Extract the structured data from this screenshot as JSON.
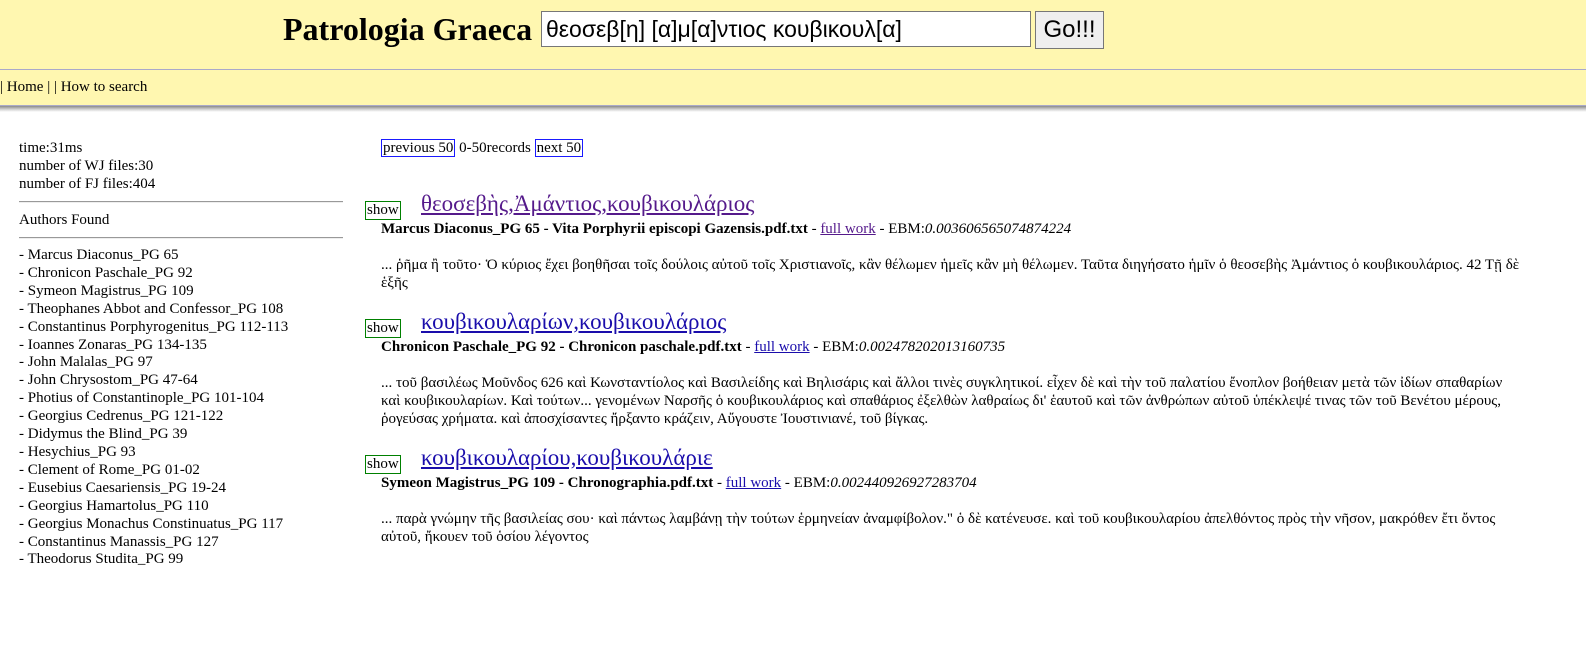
{
  "header": {
    "title": "Patrologia Graeca",
    "search_value": "θεοσεβ[η] [α]μ[α]ντιος κουβικουλ[α]",
    "go_label": "Go!!!"
  },
  "nav": {
    "home": "Home",
    "how_to_search": "How to search"
  },
  "stats": {
    "time": "time:31ms",
    "wj_files": "number of WJ files:30",
    "fj_files": "number of FJ files:404"
  },
  "authors": {
    "title": "Authors Found",
    "items": [
      "- Marcus Diaconus_PG 65",
      "- Chronicon Paschale_PG 92",
      "- Symeon Magistrus_PG 109",
      "- Theophanes Abbot and Confessor_PG 108",
      "- Constantinus Porphyrogenitus_PG 112-113",
      "- Ioannes Zonaras_PG 134-135",
      "- John Malalas_PG 97",
      "- John Chrysostom_PG 47-64",
      "- Photius of Constantinople_PG 101-104",
      "- Georgius Cedrenus_PG 121-122",
      "- Didymus the Blind_PG 39",
      "- Hesychius_PG 93",
      "- Clement of Rome_PG 01-02",
      "- Eusebius Caesariensis_PG 19-24",
      "- Georgius Hamartolus_PG 110",
      "- Georgius Monachus Constinuatus_PG 117",
      "- Constantinus Manassis_PG 127",
      "- Theodorus Studita_PG 99"
    ]
  },
  "pager": {
    "previous": "previous 50",
    "range": "0-50records",
    "next": "next 50"
  },
  "results": [
    {
      "show": "show",
      "title": "θεοσεβὴς,Ἀμάντιος,κουβικουλάριος",
      "source": "Marcus Diaconus_PG 65 - Vita Porphyrii episcopi Gazensis.pdf.txt",
      "full_work": "full work",
      "ebm_label": "- EBM:",
      "ebm": "0.003606565074874224",
      "snippet": "... ῥῆμα ἢ τοῦτο· Ὁ κύριος ἔχει βοηθῆσαι τοῖς δούλοις αὐτοῦ τοῖς Χριστιανοῖς, κἂν θέλωμεν ἡμεῖς κἂν μὴ θέλωμεν. Ταῦτα διηγήσατο ἡμῖν ὁ θεοσεβὴς Ἀμάντιος ὁ κουβικουλάριος. 42 Τῇ δὲ ἑξῆς"
    },
    {
      "show": "show",
      "title": "κουβικουλαρίων,κουβικουλάριος",
      "source": "Chronicon Paschale_PG 92 - Chronicon paschale.pdf.txt",
      "full_work": "full work",
      "ebm_label": "- EBM:",
      "ebm": "0.002478202013160735",
      "snippet": "... τοῦ βασιλέως Μοῦνδος 626 καὶ Κωνσταντίολος καὶ Βασιλείδης καὶ Βηλισάρις καὶ ἄλλοι τινὲς συγκλητικοί. εἶχεν δὲ καὶ τὴν τοῦ παλατίου ἔνοπλον βοήθειαν μετὰ τῶν ἰδίων σπαθαρίων καὶ κουβικουλαρίων. Καὶ τούτων... γενομένων Ναρσῆς ὁ κουβικουλάριος καὶ σπαθάριος ἐξελθὼν λαθραίως δι' ἑαυτοῦ καὶ τῶν ἀνθρώπων αὐτοῦ ὑπέκλεψέ τινας τῶν τοῦ Βενέτου μέρους, ῥογεύσας χρήματα. καὶ ἀποσχίσαντες ἤρξαντο κράζειν, Αὔγουστε Ἰουστινιανέ, τοῦ βίγκας."
    },
    {
      "show": "show",
      "title": "κουβικουλαρίου,κουβικουλάριε",
      "source": "Symeon Magistrus_PG 109 - Chronographia.pdf.txt",
      "full_work": "full work",
      "ebm_label": "- EBM:",
      "ebm": "0.002440926927283704",
      "snippet": "... παρὰ γνώμην τῆς βασιλείας σου· καὶ πάντως λαμβάνῃ τὴν τούτων ἑρμηνείαν ἀναμφίβολον.\" ὁ δὲ κατένευσε. καὶ τοῦ κουβικουλαρίου ἀπελθόντος πρὸς τὴν νῆσον, μακρόθεν ἔτι ὄντος αὐτοῦ, ἤκουεν τοῦ ὁσίου λέγοντος"
    }
  ]
}
